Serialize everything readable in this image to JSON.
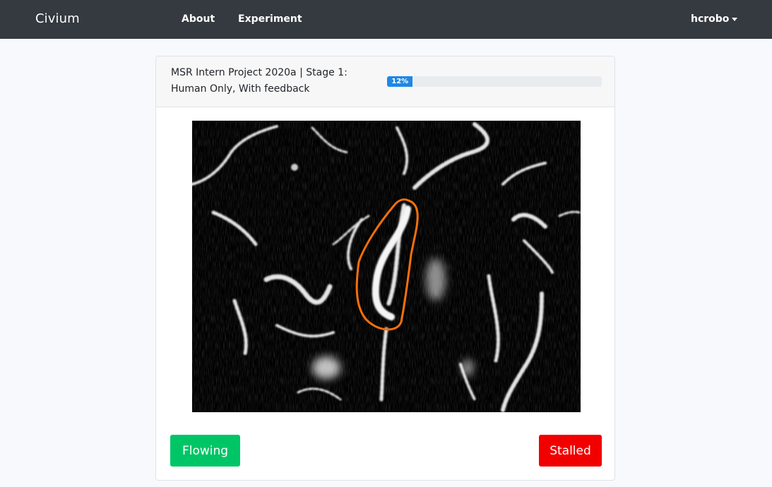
{
  "navbar": {
    "brand": "Civium",
    "links": [
      "About",
      "Experiment"
    ],
    "user": "hcrobo"
  },
  "task": {
    "title": "MSR Intern Project 2020a | Stage 1: Human Only, With feedback",
    "progress_label": "12%",
    "progress_fraction": 0.12
  },
  "image": {
    "annotation_color": "#f7700a"
  },
  "buttons": {
    "flowing": "Flowing",
    "stalled": "Stalled"
  },
  "colors": {
    "navbar_bg": "#343a40",
    "progress_fill": "#1e88e5",
    "flowing": "#00c566",
    "stalled": "#f20000"
  }
}
